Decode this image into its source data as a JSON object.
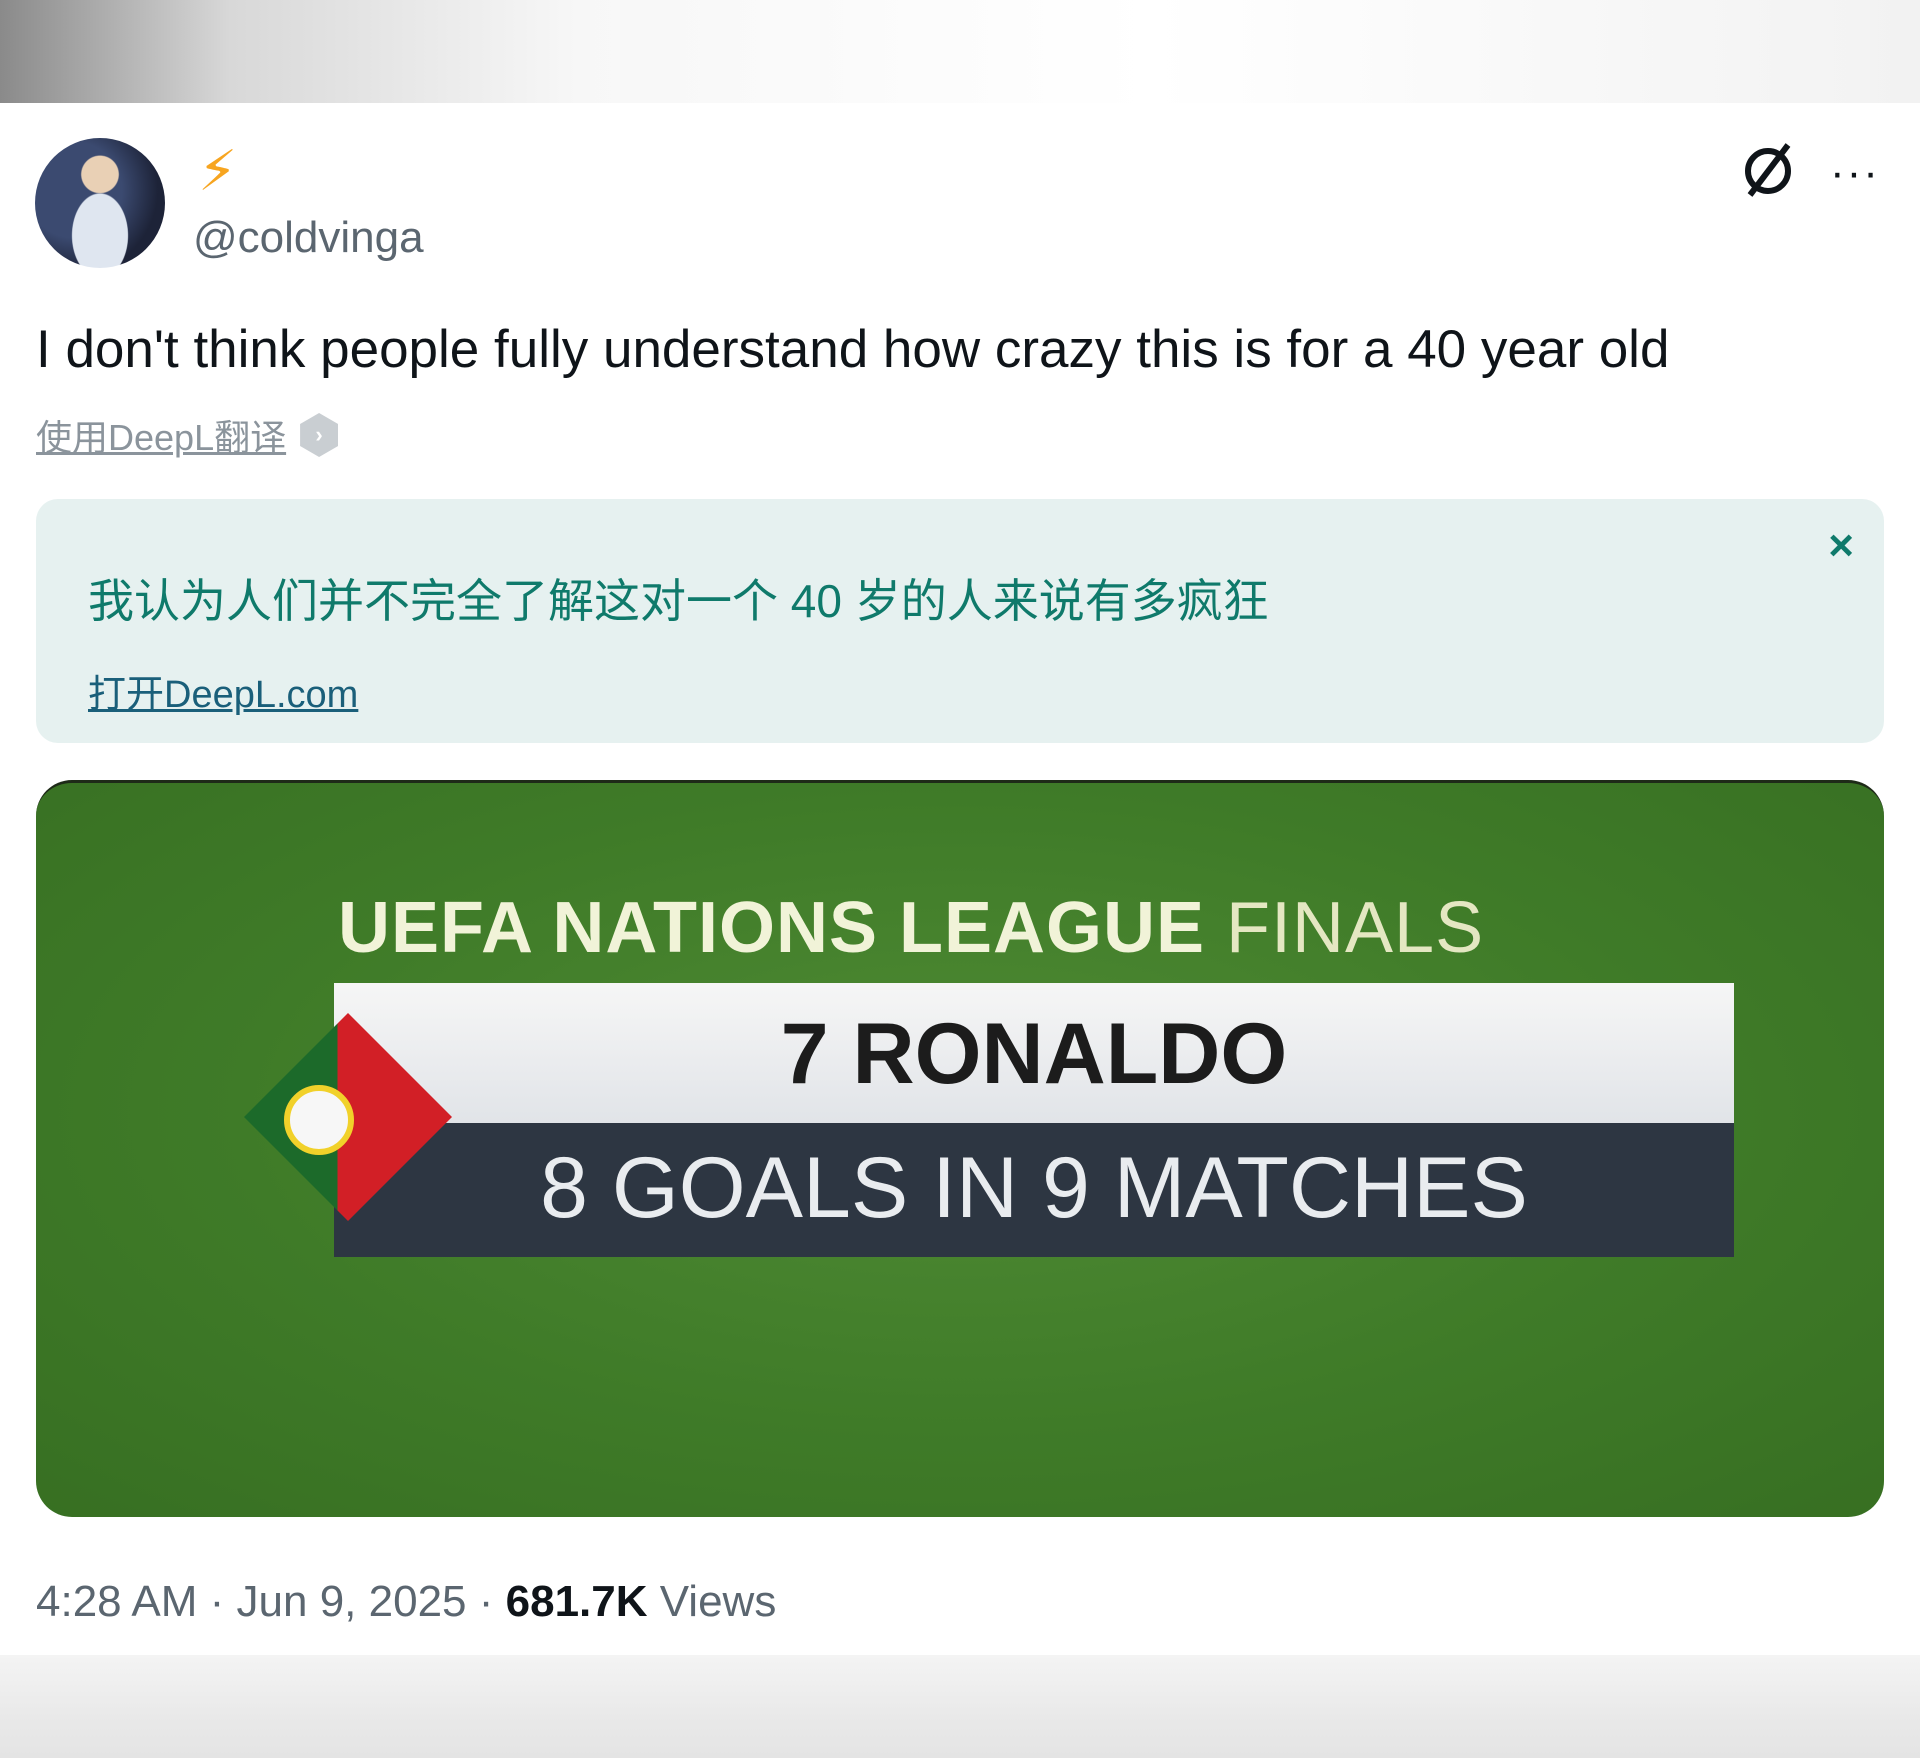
{
  "tweet": {
    "author_handle": "@coldvinga",
    "author_badge": "⚡",
    "text": "I don't think people fully understand how crazy this is for a 40 year old"
  },
  "translate": {
    "link_label": "使用DeepL翻译",
    "badge_icon": "deepl-icon",
    "translated_text": "我认为人们并不完全了解这对一个 40 岁的人来说有多疯狂",
    "open_link_label": "打开DeepL.com",
    "close_symbol": "×"
  },
  "media": {
    "headline_main": "UEFA NATIONS LEAGUE ",
    "headline_tail": "FINALS",
    "player_name": "7 RONALDO",
    "stat_line": "8 GOALS IN 9 MATCHES",
    "flag": "portugal-flag"
  },
  "meta": {
    "time": "4:28 AM",
    "separator": " · ",
    "date": "Jun 9, 2025",
    "views_count": "681.7K",
    "views_label": "Views"
  },
  "icons": {
    "grok": "grok-icon",
    "more": "more-icon",
    "more_symbol": "···"
  },
  "colors": {
    "translation_bg": "#e6f1f0",
    "translation_text": "#0f7a6b",
    "pitch_green": "#3f7b28"
  }
}
